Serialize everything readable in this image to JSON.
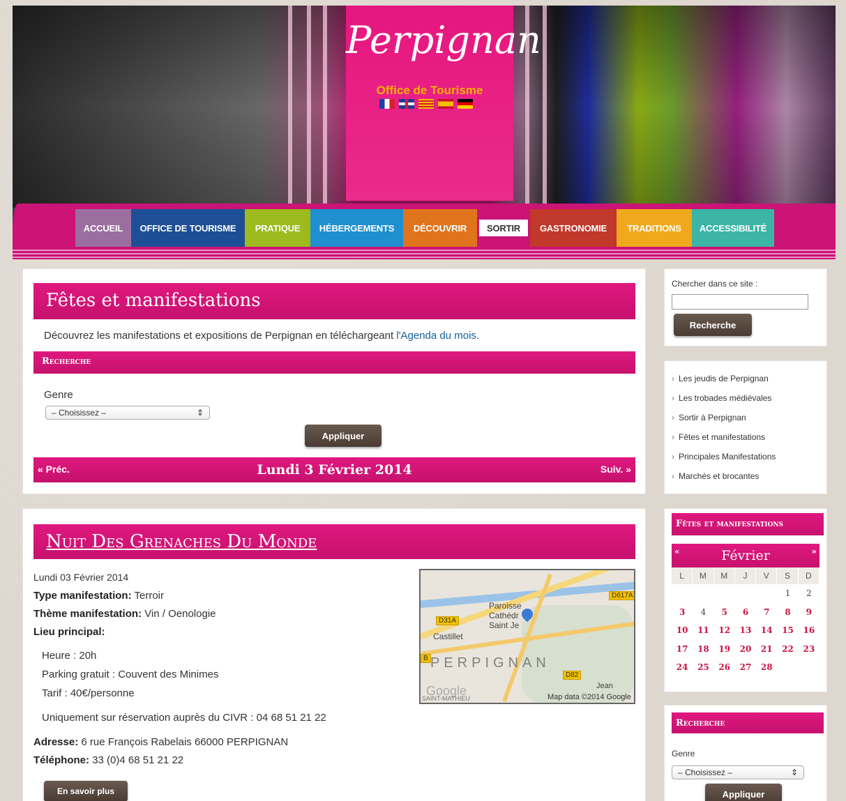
{
  "header": {
    "logo_text": "Perpignan",
    "logo_subtitle": "Office de Tourisme",
    "flags": [
      "fr",
      "uk",
      "ca",
      "es",
      "de"
    ]
  },
  "nav": {
    "items": [
      {
        "label": "ACCUEIL",
        "color": "#9a6fa0"
      },
      {
        "label": "OFFICE DE TOURISME",
        "color": "#1e4f96"
      },
      {
        "label": "PRATIQUE",
        "color": "#9dba1f"
      },
      {
        "label": "HÉBERGEMENTS",
        "color": "#1f8fd0"
      },
      {
        "label": "DÉCOUVRIR",
        "color": "#e0741c"
      },
      {
        "label": "SORTIR",
        "color": "#ffffff"
      },
      {
        "label": "GASTRONOMIE",
        "color": "#c0392b"
      },
      {
        "label": "TRADITIONS",
        "color": "#f0a91c"
      },
      {
        "label": "ACCESSIBILITÉ",
        "color": "#3cb5a6"
      }
    ]
  },
  "main": {
    "title": "Fêtes et manifestations",
    "intro_text": "Découvrez les manifestations et expositions de Perpignan en téléchargeant ",
    "intro_link": "l'Agenda du mois",
    "intro_end": ".",
    "search_bar": "Recherche",
    "genre_label": "Genre",
    "genre_value": "– Choisissez –",
    "apply_label": "Appliquer",
    "prev_label": "« Préc.",
    "next_label": "Suiv. »",
    "date_label": "Lundi 3 Février 2014"
  },
  "event": {
    "title": "Nuit Des Grenaches Du Monde",
    "date": "Lundi 03 Février 2014",
    "type_label": "Type manifestation:",
    "type_value": "Terroir",
    "theme_label": "Thème manifestation:",
    "theme_value": "Vin / Oenologie",
    "lieu_label": "Lieu principal:",
    "details": [
      "Heure : 20h",
      "Parking gratuit : Couvent des Minimes",
      "Tarif : 40€/personne"
    ],
    "reservation": "Uniquement sur réservation auprès du CIVR : 04 68 51 21 22",
    "address_label": "Adresse:",
    "address_value": "6 rue François Rabelais 66000 PERPIGNAN",
    "phone_label": "Téléphone:",
    "phone_value": "33 (0)4 68 51 21 22",
    "more_label": "En savoir plus",
    "map": {
      "label_paroisse": "Paroisse",
      "label_cathed": "Cathédr",
      "label_saint": "Saint Je",
      "label_castillet": "Castillet",
      "label_perpignan": "PERPIGNAN",
      "tag_d617a": "D617A",
      "tag_d31a": "D31A",
      "tag_d82": "D82",
      "tag_b": "B",
      "google": "Google",
      "saint_mathieu": "SAINT-MATHIEU",
      "jean": "Jean",
      "copyright": "Map data ©2014 Google"
    }
  },
  "sidebar": {
    "search_label": "Chercher dans ce site :",
    "search_button": "Recherche",
    "links": [
      "Les jeudis de Perpignan",
      "Les trobades médiévales",
      "Sortir à Perpignan",
      "Fêtes et manifestations",
      "Principales Manifestations",
      "Marchés et brocantes"
    ],
    "cal_title": "Fêtes et manifestations",
    "cal_prev": "«",
    "cal_next": "»",
    "cal_month": "Février",
    "cal_dow": [
      "L",
      "M",
      "M",
      "J",
      "V",
      "S",
      "D"
    ],
    "cal_rows": [
      [
        "",
        "",
        "",
        "",
        "",
        "1",
        "2"
      ],
      [
        "3",
        "4",
        "5",
        "6",
        "7",
        "8",
        "9"
      ],
      [
        "10",
        "11",
        "12",
        "13",
        "14",
        "15",
        "16"
      ],
      [
        "17",
        "18",
        "19",
        "20",
        "21",
        "22",
        "23"
      ],
      [
        "24",
        "25",
        "26",
        "27",
        "28",
        "",
        ""
      ]
    ],
    "cal_highlight": [
      "3",
      "5",
      "6",
      "7",
      "8",
      "9",
      "10",
      "11",
      "12",
      "13",
      "14",
      "15",
      "16",
      "17",
      "18",
      "19",
      "20",
      "21",
      "22",
      "23",
      "24",
      "25",
      "26",
      "27",
      "28"
    ],
    "search2_title": "Recherche",
    "genre_label": "Genre",
    "genre_value": "– Choisissez –",
    "apply_label": "Appliquer"
  }
}
